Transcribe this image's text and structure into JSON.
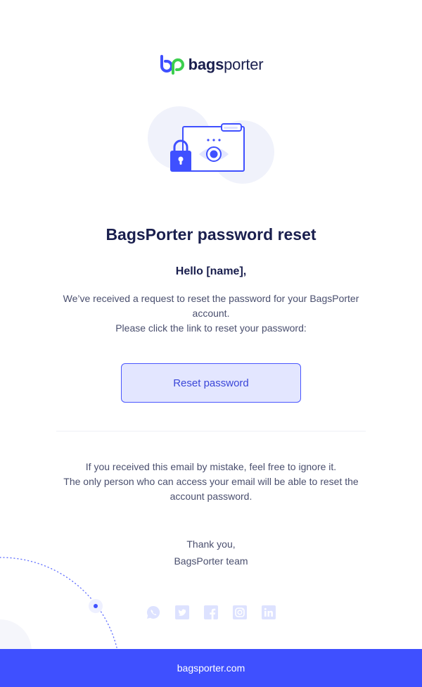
{
  "brand": {
    "name_bold": "bags",
    "name_light": "porter",
    "colors": {
      "primary": "#3f50ff",
      "accent_green": "#3ccf4e",
      "navy": "#1a1f4e"
    }
  },
  "email": {
    "title": "BagsPorter password reset",
    "greeting": "Hello [name],",
    "body_line1": "We’ve received a request to reset the password for your BagsPorter account.",
    "body_line2": "Please click the link to reset your password:",
    "reset_button": "Reset password",
    "notice_line1": "If you received this email by mistake, feel free to ignore it.",
    "notice_line2": "The only person who can access your email will be able to reset the account password.",
    "thanks": "Thank you,",
    "team": "BagsPorter team"
  },
  "socials": [
    "whatsapp-icon",
    "twitter-icon",
    "facebook-icon",
    "instagram-icon",
    "linkedin-icon"
  ],
  "footer": {
    "link": "bagsporter.com"
  }
}
